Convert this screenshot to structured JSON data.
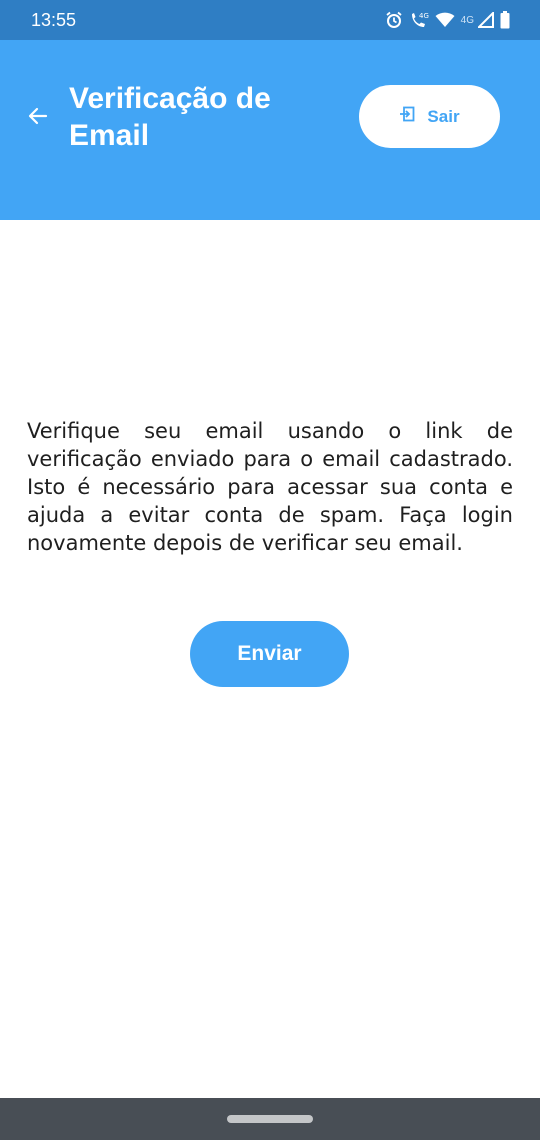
{
  "status_bar": {
    "time": "13:55",
    "network_label": "4G",
    "icons": [
      "alarm-icon",
      "wifi-calling-icon",
      "wifi-icon",
      "signal-icon",
      "battery-icon"
    ]
  },
  "app_bar": {
    "title": "Verificação de Email",
    "back_icon": "arrow-back-icon",
    "logout": {
      "label": "Sair",
      "icon": "logout-icon"
    }
  },
  "main": {
    "message": "Verifique seu email usando o link de verificação enviado para o email cadastrado. Isto é necessário para acessar sua conta e ajuda a evitar conta de spam. Faça login novamente depois de verificar seu email.",
    "send_button_label": "Enviar"
  },
  "colors": {
    "primary": "#42a5f5",
    "status_bar": "#2f7ec4",
    "nav_bar": "#484e55",
    "text": "#1f1f1f",
    "background": "#ffffff"
  }
}
